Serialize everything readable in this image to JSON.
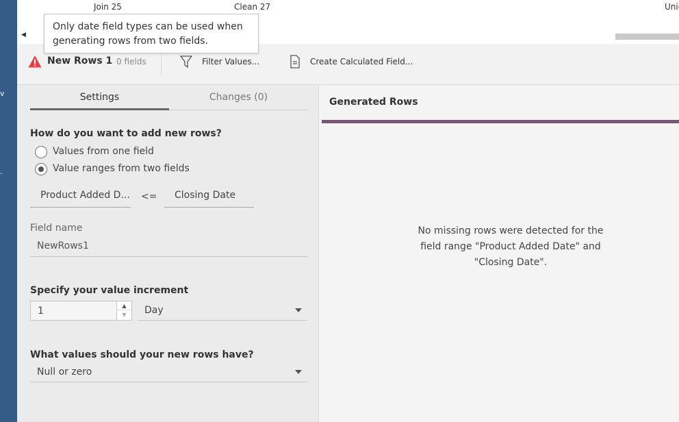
{
  "flow": {
    "nodes": [
      "Join 25",
      "Clean 27",
      "Unio"
    ]
  },
  "tooltip": {
    "text": "Only date field types can be used when generating rows from two fields."
  },
  "toolbar": {
    "step_name": "New Rows 1",
    "field_count": "0 fields",
    "filter_label": "Filter Values...",
    "calc_label": "Create Calculated Field..."
  },
  "settings": {
    "tabs": [
      "Settings",
      "Changes (0)"
    ],
    "add_question": "How do you want to add new rows?",
    "options": [
      "Values from one field",
      "Value ranges from two fields"
    ],
    "selected_option": "Value ranges from two fields",
    "range_start": "Product Added D...",
    "operator": "<=",
    "range_end": "Closing Date",
    "field_name_label": "Field name",
    "field_name_value": "NewRows1",
    "increment_question": "Specify your value increment",
    "increment_value": "1",
    "increment_unit": "Day",
    "values_question": "What values should your new rows have?",
    "values_option": "Null or zero"
  },
  "main": {
    "title": "Generated Rows",
    "message": "No missing rows were detected for the field range \"Product Added Date\" and \"Closing Date\"."
  },
  "colors": {
    "left_rail": "#355b87",
    "accent_bar": "#7a5676",
    "warning": "#e2404a"
  }
}
